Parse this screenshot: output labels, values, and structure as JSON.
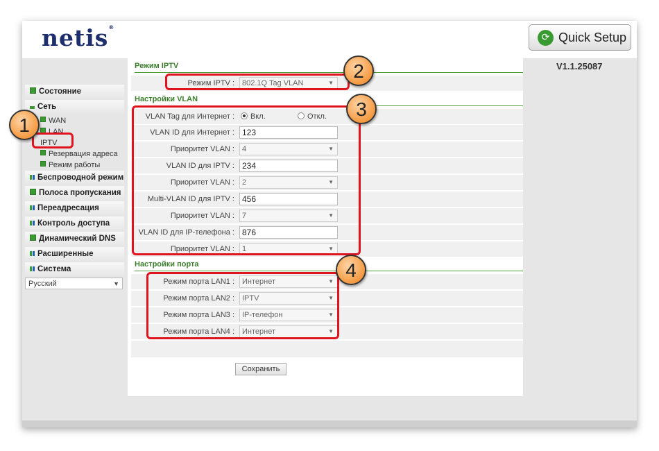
{
  "brand": {
    "logo_text": "netis",
    "reg_mark": "®"
  },
  "header": {
    "quick_setup_label": "Quick Setup",
    "version": "V1.1.25087"
  },
  "sidebar": {
    "items": [
      {
        "label": "Состояние"
      },
      {
        "label": "Сеть"
      },
      {
        "label": "Беспроводной режим"
      },
      {
        "label": "Полоса пропускания"
      },
      {
        "label": "Переадресация"
      },
      {
        "label": "Контроль доступа"
      },
      {
        "label": "Динамический DNS"
      },
      {
        "label": "Расширенные"
      },
      {
        "label": "Система"
      }
    ],
    "sub_items": [
      {
        "label": "WAN"
      },
      {
        "label": "LAN"
      },
      {
        "label": "IPTV"
      },
      {
        "label": "Резервация адреса"
      },
      {
        "label": "Режим работы"
      }
    ],
    "language": "Русский"
  },
  "iptv": {
    "section_title": "Режим IPTV",
    "mode_label": "Режим IPTV :",
    "mode_value": "802.1Q Tag VLAN"
  },
  "vlan": {
    "section_title": "Настройки VLAN",
    "tag_label": "VLAN Tag для Интернет :",
    "tag_on": "Вкл.",
    "tag_off": "Откл.",
    "rows": [
      {
        "label": "VLAN ID для Интернет :",
        "value": "123"
      },
      {
        "label": "Приоритет VLAN :",
        "value": "4"
      },
      {
        "label": "VLAN ID для IPTV :",
        "value": "234"
      },
      {
        "label": "Приоритет VLAN :",
        "value": "2"
      },
      {
        "label": "Multi-VLAN ID для IPTV :",
        "value": "456"
      },
      {
        "label": "Приоритет VLAN :",
        "value": "7"
      },
      {
        "label": "VLAN ID для IP-телефона :",
        "value": "876"
      },
      {
        "label": "Приоритет VLAN :",
        "value": "1"
      }
    ]
  },
  "ports": {
    "section_title": "Настройки порта",
    "rows": [
      {
        "label": "Режим порта LAN1 :",
        "value": "Интернет"
      },
      {
        "label": "Режим порта LAN2 :",
        "value": "IPTV"
      },
      {
        "label": "Режим порта LAN3 :",
        "value": "IP-телефон"
      },
      {
        "label": "Режим порта LAN4 :",
        "value": "Интернет"
      }
    ]
  },
  "save_label": "Сохранить",
  "annotations": {
    "n1": "1",
    "n2": "2",
    "n3": "3",
    "n4": "4"
  },
  "colors": {
    "accent_green": "#3c7f2c",
    "highlight_red": "#e0141e",
    "logo_blue": "#1d2e6e"
  }
}
